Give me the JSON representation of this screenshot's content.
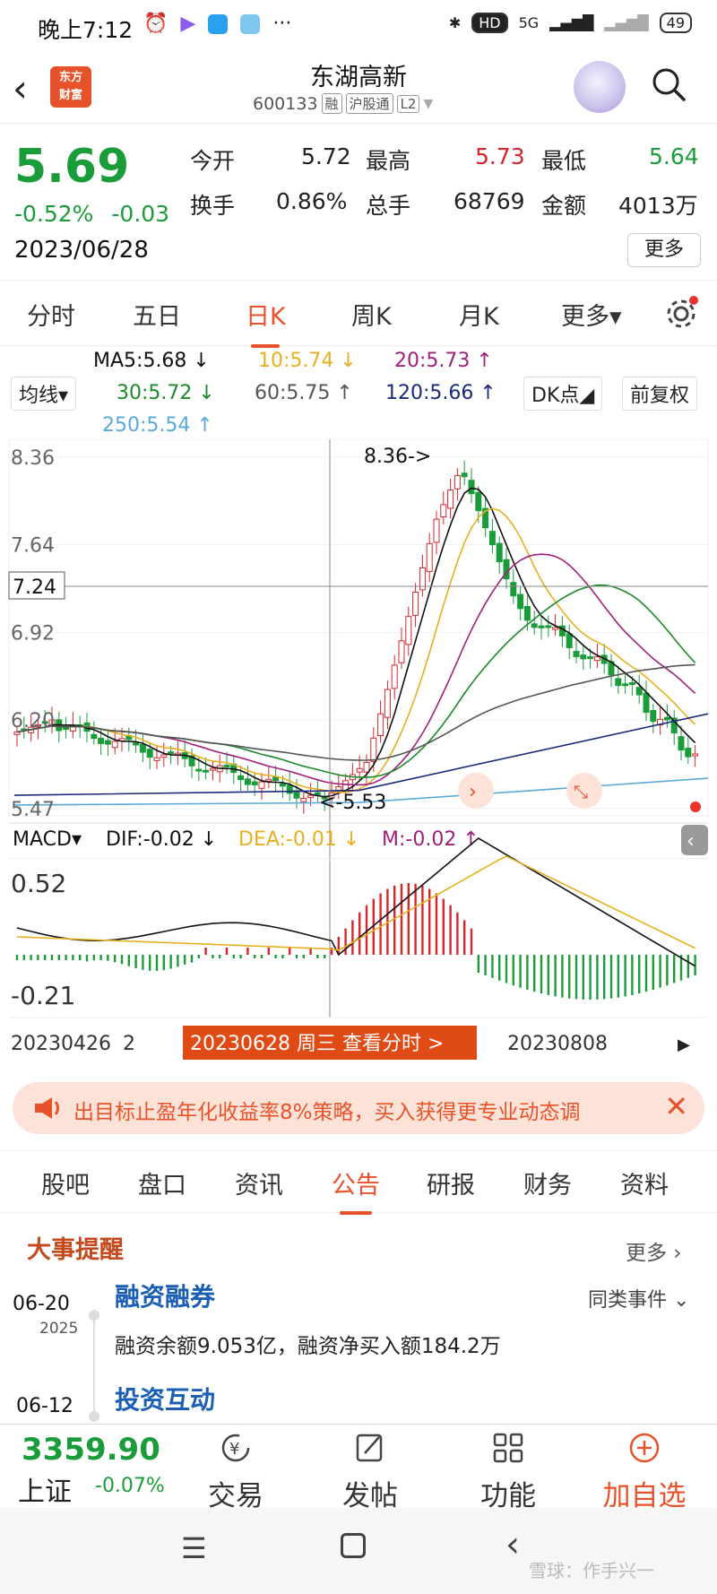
{
  "status_bar": {
    "time": "晚上7:12",
    "dots": "···",
    "network": "5G",
    "battery": "49"
  },
  "header": {
    "title": "东湖高新",
    "code": "600133",
    "tags": [
      "融",
      "沪股通",
      "L2"
    ],
    "logo_text": [
      "东方",
      "财富"
    ]
  },
  "quote": {
    "price": "5.69",
    "change_pct": "-0.52%",
    "change": "-0.03",
    "date": "2023/06/28",
    "fields": [
      {
        "label": "今开",
        "value": "5.72",
        "color": "#222222"
      },
      {
        "label": "最高",
        "value": "5.73",
        "color": "#d6262c"
      },
      {
        "label": "最低",
        "value": "5.64",
        "color": "#1b9c3a"
      },
      {
        "label": "换手",
        "value": "0.86%",
        "color": "#222222"
      },
      {
        "label": "总手",
        "value": "68769",
        "color": "#222222"
      },
      {
        "label": "金额",
        "value": "4013万",
        "color": "#222222"
      }
    ],
    "more": "更多"
  },
  "period_tabs": [
    "分时",
    "五日",
    "日K",
    "周K",
    "月K",
    "更多▾"
  ],
  "ma_legend": {
    "ma5": "MA5:5.68 ↓",
    "ma10": "10:5.74 ↓",
    "ma20": "20:5.73 ↑",
    "ma30": "30:5.72 ↓",
    "ma60": "60:5.75 ↑",
    "ma120": "120:5.66 ↑",
    "ma250": "250:5.54 ↑",
    "avg_btn": "均线▾",
    "dk_btn": "DK点◢",
    "fq_btn": "前复权"
  },
  "colors": {
    "ma5": "#111111",
    "ma10": "#e8b020",
    "ma20": "#a0207a",
    "ma30": "#1b8a2a",
    "ma60": "#555555",
    "ma120": "#1a2a7a",
    "ma250": "#5aaad8",
    "up": "#d6262c",
    "down": "#1b9c3a",
    "accent": "#e8522a"
  },
  "chart_data": {
    "type": "candlestick",
    "y_axis_labels": [
      "8.36",
      "7.64",
      "6.92",
      "6.20",
      "5.47"
    ],
    "crosshair_price": "7.24",
    "high_marker": "8.36->",
    "low_marker": "<-5.53",
    "macd": {
      "label": "MACD▾",
      "dif": "DIF:-0.02 ↓",
      "dea": "DEA:-0.01 ↓",
      "m": "M:-0.02 ↑",
      "y_top": "0.52",
      "y_bottom": "-0.21"
    },
    "x_labels": [
      "20230426",
      "2",
      "20230808"
    ],
    "selected_date": "20230628 周三 查看分时 >"
  },
  "banner": {
    "text": "出目标止盈年化收益率8%策略，买入获得更专业动态调"
  },
  "info_tabs": [
    "股吧",
    "盘口",
    "资讯",
    "公告",
    "研报",
    "财务",
    "资料"
  ],
  "events": {
    "title": "大事提醒",
    "more": "更多",
    "items": [
      {
        "date": "06-20",
        "year": "2025",
        "title": "融资融券",
        "text": "融资余额9.053亿，融资净买入额184.2万",
        "same": "同类事件"
      },
      {
        "date": "06-12",
        "year": "",
        "title": "投资互动",
        "text": "",
        "same": ""
      }
    ]
  },
  "bottom_bar": {
    "index_value": "3359.90",
    "index_name": "上证",
    "index_change": "-0.07%",
    "buttons": [
      "交易",
      "发帖",
      "功能",
      "加自选"
    ]
  },
  "watermark": "雪球：作手兴一"
}
